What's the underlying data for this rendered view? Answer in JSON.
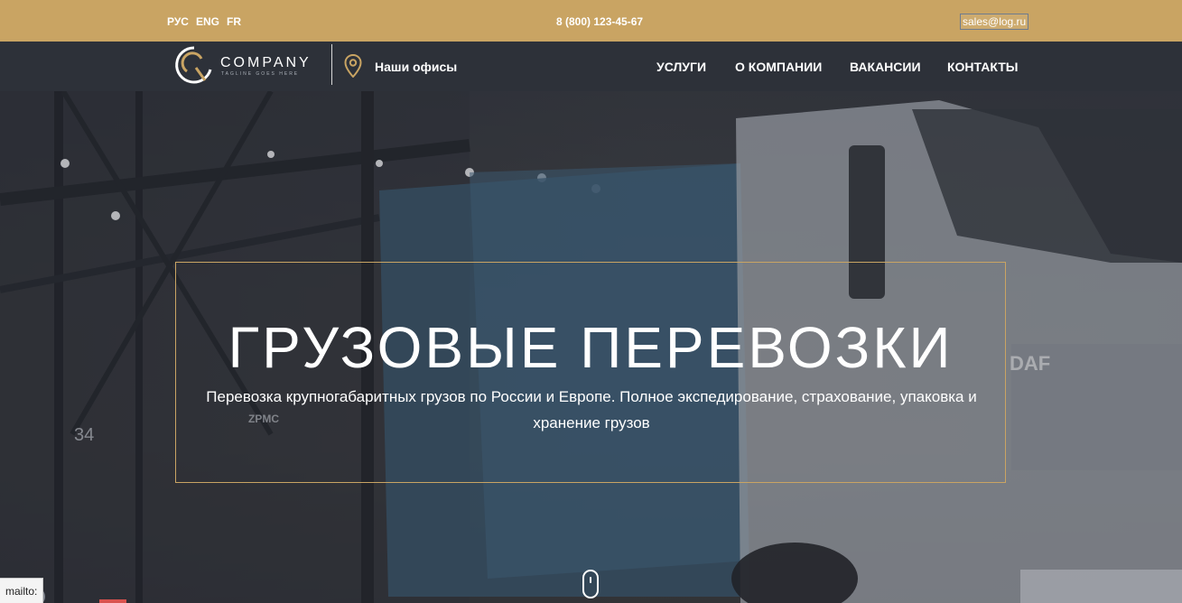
{
  "topbar": {
    "languages": [
      "РУС",
      "ENG",
      "FR"
    ],
    "phone": "8 (800) 123-45-67",
    "email": "sales@log.ru"
  },
  "navbar": {
    "logo_name": "COMPANY",
    "logo_tagline": "TAGLINE GOES HERE",
    "offices_label": "Наши офисы",
    "menu": [
      "УСЛУГИ",
      "О КОМПАНИИ",
      "ВАКАНСИИ",
      "КОНТАКТЫ"
    ]
  },
  "hero": {
    "title": "ГРУЗОВЫЕ ПЕРЕВОЗКИ",
    "subtitle": "Перевозка крупногабаритных грузов по России и Европе. Полное экспедирование, страхование, упаковка и хранение грузов",
    "side_number": "34",
    "truck_brand": "DAF",
    "container_brand": "ZPMC"
  },
  "status_bar": {
    "text": "mailto:"
  },
  "colors": {
    "accent": "#c9a463",
    "nav_bg": "#2d3139"
  }
}
